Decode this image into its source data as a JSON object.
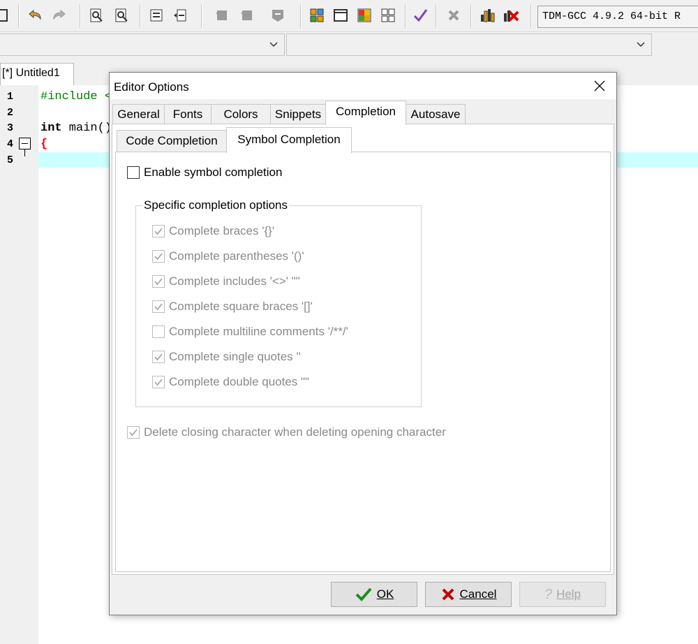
{
  "ide": {
    "compiler_label": "TDM-GCC 4.9.2 64-bit R",
    "file_tab": "[*] Untitled1",
    "line_numbers": [
      "1",
      "2",
      "3",
      "4",
      "5"
    ],
    "code": {
      "line1": "#include <",
      "line3_kw": "int",
      "line3_rest": " main()",
      "line4": "{"
    }
  },
  "dialog": {
    "title": "Editor Options",
    "tabs": [
      "General",
      "Fonts",
      "Colors",
      "Snippets",
      "Completion",
      "Autosave"
    ],
    "active_tab": "Completion",
    "subtabs": [
      "Code Completion",
      "Symbol Completion"
    ],
    "active_subtab": "Symbol Completion",
    "enable_label": "Enable symbol completion",
    "enable_checked": false,
    "group_title": "Specific completion options",
    "options": [
      {
        "label": "Complete braces '{}'",
        "checked": true
      },
      {
        "label": "Complete parentheses '()'",
        "checked": true
      },
      {
        "label": "Complete includes '<>' \"\"",
        "checked": true
      },
      {
        "label": "Complete square braces '[]'",
        "checked": true
      },
      {
        "label": "Complete multiline comments '/**/'",
        "checked": false
      },
      {
        "label": "Complete single quotes ''",
        "checked": true
      },
      {
        "label": "Complete double quotes \"\"",
        "checked": true
      }
    ],
    "delete_closing_label": "Delete closing character when deleting opening character",
    "delete_closing_checked": true,
    "buttons": {
      "ok": "OK",
      "cancel": "Cancel",
      "help": "Help"
    }
  },
  "colors": {
    "highlight_line": "#ccffff",
    "include_green": "#008000",
    "brace_red": "#ff0000",
    "ok_check": "#1a8f1a",
    "cancel_x": "#c00000"
  }
}
